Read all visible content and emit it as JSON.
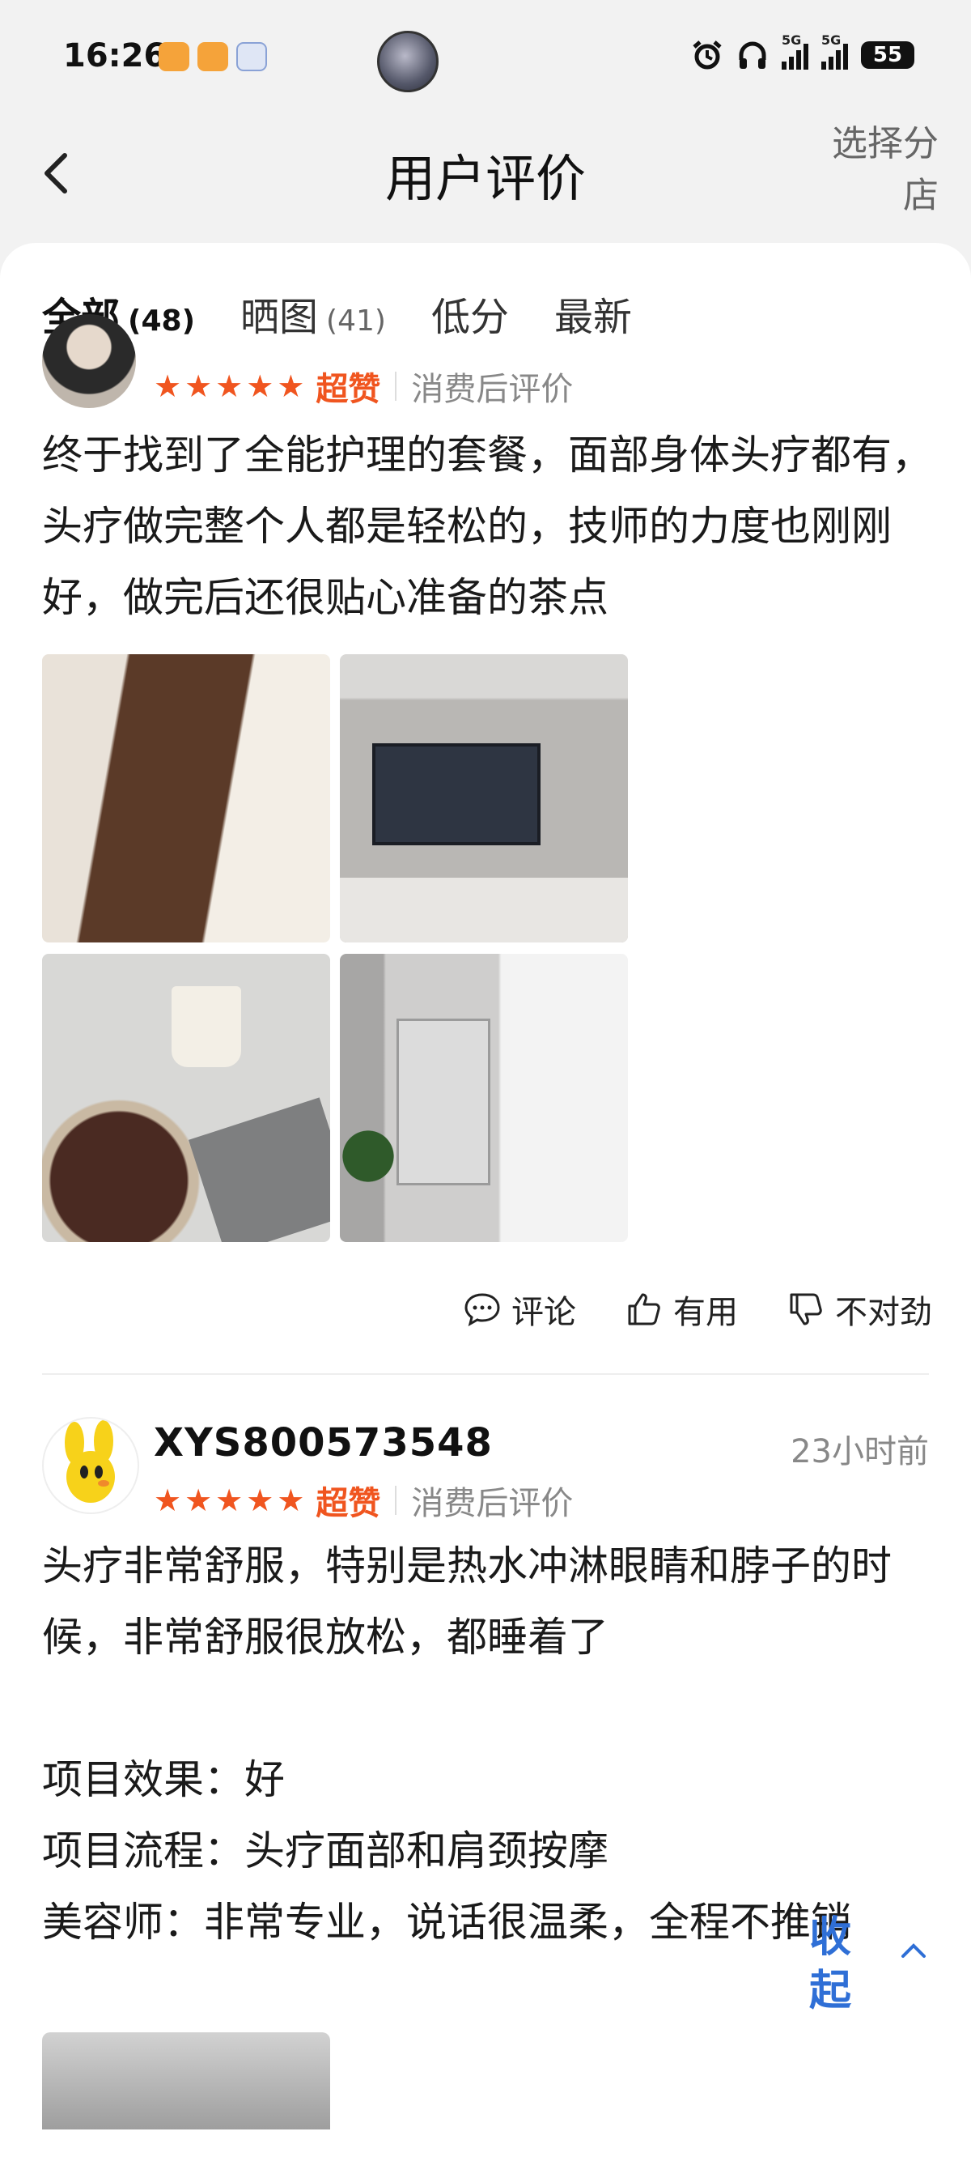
{
  "status_bar": {
    "time": "16:26",
    "signal1": "5G",
    "signal2": "5G",
    "battery": "55"
  },
  "header": {
    "title": "用户评价",
    "choose_store": "选择分店"
  },
  "tabs": [
    {
      "label": "全部",
      "count": "(48)"
    },
    {
      "label": "晒图",
      "count": "(41)"
    },
    {
      "label": "低分",
      "count": ""
    },
    {
      "label": "最新",
      "count": ""
    }
  ],
  "review1": {
    "stars": 5,
    "rating_label": "超赞",
    "type": "消费后评价",
    "text": "终于找到了全能护理的套餐，面部身体头疗都有，头疗做完整个人都是轻松的，技师的力度也刚刚好，做完后还很贴心准备的茶点"
  },
  "actions": {
    "comment": "评论",
    "useful": "有用",
    "not_right": "不对劲"
  },
  "review2": {
    "user": "XYS800573548",
    "time": "23小时前",
    "stars": 5,
    "rating_label": "超赞",
    "type": "消费后评价",
    "text": "头疗非常舒服，特别是热水冲淋眼睛和脖子的时候，非常舒服很放松，都睡着了\n\n项目效果：好\n项目流程：头疗面部和肩颈按摩\n美容师：非常专业，说话很温柔，全程不推销",
    "collapse": "收起"
  }
}
